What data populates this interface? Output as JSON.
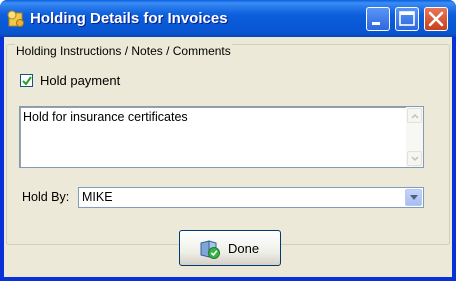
{
  "window": {
    "title": "Holding Details for Invoices",
    "icon": "app-icon"
  },
  "caption_buttons": {
    "minimize": "minimize-icon",
    "maximize": "maximize-icon",
    "close": "close-icon"
  },
  "group": {
    "legend": "Holding Instructions / Notes / Comments"
  },
  "hold_payment": {
    "label": "Hold payment",
    "checked": true
  },
  "notes": {
    "value": "Hold for insurance certificates"
  },
  "hold_by": {
    "label": "Hold By:",
    "value": "MIKE"
  },
  "done_button": {
    "label": "Done",
    "icon": "done-icon"
  },
  "colors": {
    "title_bar": "#0a5fe3",
    "client": "#ece9d8",
    "close_button": "#c8401c"
  }
}
